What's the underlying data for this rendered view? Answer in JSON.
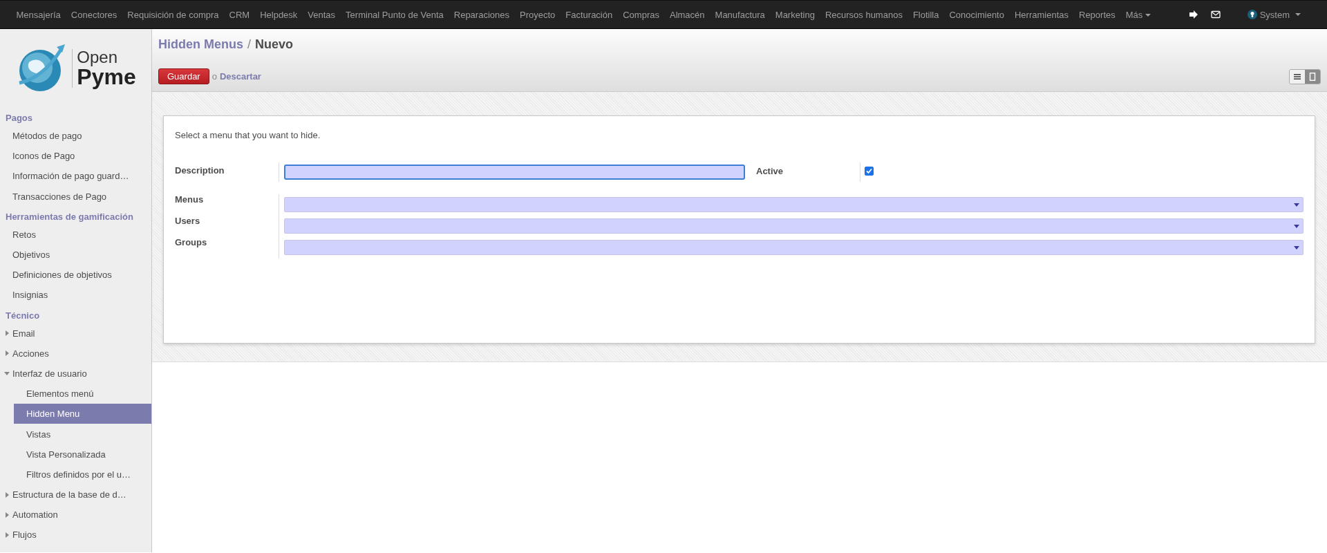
{
  "top_menu": {
    "items": [
      "Mensajería",
      "Conectores",
      "Requisición de compra",
      "CRM",
      "Helpdesk",
      "Ventas",
      "Terminal Punto de Venta",
      "Reparaciones",
      "Proyecto",
      "Facturación",
      "Compras",
      "Almacén",
      "Manufactura",
      "Marketing",
      "Recursos humanos",
      "Flotilla",
      "Conocimiento",
      "Herramientas",
      "Reportes"
    ],
    "more": "Más",
    "user": "System"
  },
  "logo": {
    "line1": "Open",
    "line2": "Pyme"
  },
  "sidebar": {
    "sections": [
      {
        "title": "Pagos",
        "items": [
          {
            "label": "Métodos de pago",
            "kind": "leaf",
            "selected": false
          },
          {
            "label": "Iconos de Pago",
            "kind": "leaf",
            "selected": false
          },
          {
            "label": "Información de pago guard…",
            "kind": "leaf",
            "selected": false
          },
          {
            "label": "Transacciones de Pago",
            "kind": "leaf",
            "selected": false
          }
        ]
      },
      {
        "title": "Herramientas de gamificación",
        "items": [
          {
            "label": "Retos",
            "kind": "leaf",
            "selected": false
          },
          {
            "label": "Objetivos",
            "kind": "leaf",
            "selected": false
          },
          {
            "label": "Definiciones de objetivos",
            "kind": "leaf",
            "selected": false
          },
          {
            "label": "Insignias",
            "kind": "leaf",
            "selected": false
          }
        ]
      },
      {
        "title": "Técnico",
        "items": [
          {
            "label": "Email",
            "kind": "folder",
            "expanded": false,
            "selected": false
          },
          {
            "label": "Acciones",
            "kind": "folder",
            "expanded": false,
            "selected": false
          },
          {
            "label": "Interfaz de usuario",
            "kind": "folder",
            "expanded": true,
            "selected": false,
            "children": [
              {
                "label": "Elementos menú",
                "selected": false
              },
              {
                "label": "Hidden Menu",
                "selected": true
              },
              {
                "label": "Vistas",
                "selected": false
              },
              {
                "label": "Vista Personalizada",
                "selected": false
              },
              {
                "label": "Filtros definidos por el u…",
                "selected": false
              }
            ]
          },
          {
            "label": "Estructura de la base de d…",
            "kind": "folder",
            "expanded": false,
            "selected": false
          },
          {
            "label": "Automation",
            "kind": "folder",
            "expanded": false,
            "selected": false
          },
          {
            "label": "Flujos",
            "kind": "folder",
            "expanded": false,
            "selected": false
          }
        ]
      }
    ]
  },
  "header": {
    "breadcrumb": [
      "Hidden Menus",
      "Nuevo"
    ],
    "breadcrumb_separator": "/",
    "save": "Guardar",
    "separator": "o",
    "discard": "Descartar",
    "views": [
      {
        "kind": "list",
        "selected": false
      },
      {
        "kind": "form",
        "selected": true
      }
    ]
  },
  "form": {
    "intro": "Select a menu that you want to hide.",
    "description": {
      "label": "Description",
      "focused": true
    },
    "active": {
      "label": "Active",
      "checked": true
    },
    "relations": [
      {
        "label": "Menus"
      },
      {
        "label": "Users"
      },
      {
        "label": "Groups"
      }
    ]
  }
}
